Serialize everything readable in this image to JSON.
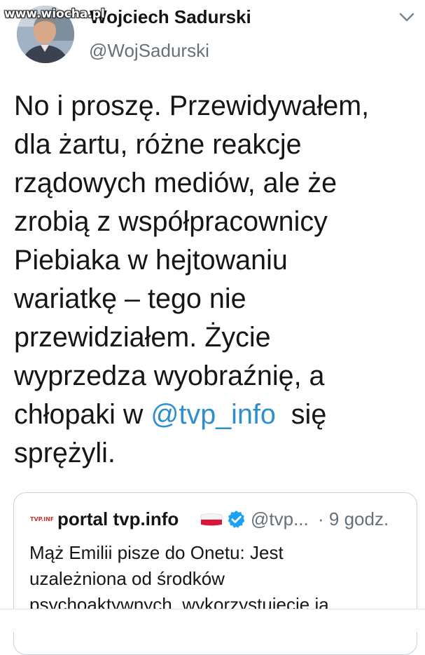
{
  "watermark": "www.wiocha.pl",
  "author": {
    "display_name": "Wojciech Sadurski",
    "handle": "@WojSadurski"
  },
  "tweet": {
    "lines": [
      "No i proszę. Przewidywałem,",
      "dla żartu, różne reakcje",
      "rządowych mediów, ale że",
      "zrobią z współpracownicy",
      "Piebiaka w hejtowaniu",
      "wariatkę – tego nie",
      "przewidziałem. Życie",
      "wyprzedza wyobraźnię, a"
    ],
    "line9_before": "chłopaki w ",
    "mention": "@tvp_info",
    "line9_after": "  się",
    "line10": "sprężyli."
  },
  "quoted": {
    "logo_text": "TVP.INFO",
    "display_name": "portal tvp.info",
    "handle": "@tvp...",
    "time": "· 9 godz.",
    "lines": [
      "Mąż Emilii pisze do Onetu: Jest",
      "uzależniona od środków",
      "psychoaktywnych, wykorzystujecie ją"
    ]
  },
  "colors": {
    "link": "#2f8fcc",
    "secondary_text": "#66707a",
    "verified": "#1da1f2"
  }
}
